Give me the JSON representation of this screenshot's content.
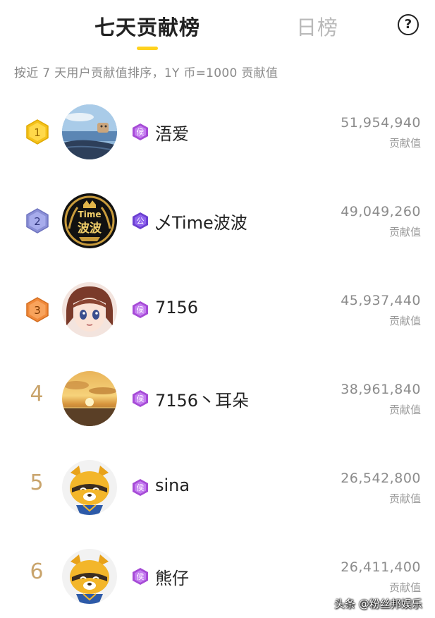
{
  "header": {
    "tab_active": "七天贡献榜",
    "tab_inactive": "日榜",
    "help_symbol": "?",
    "accent_color": "#ffd21e"
  },
  "subtitle": "按近 7 天用户贡献值排序，1Y 币=1000 贡献值",
  "rows": [
    {
      "rank": "1",
      "badge_color": "#f4c21b",
      "level": "侯",
      "level_color": "#a64bd6",
      "name": "浯爱",
      "value": "51,954,940",
      "unit": "贡献值",
      "avatar": "sea-landscape"
    },
    {
      "rank": "2",
      "badge_color": "#8a8fd6",
      "level": "公",
      "level_color": "#6b3fd0",
      "name": "乄Time波波",
      "value": "49,049,260",
      "unit": "贡献值",
      "avatar": "time-bobo-emblem"
    },
    {
      "rank": "3",
      "badge_color": "#f0893a",
      "level": "侯",
      "level_color": "#a64bd6",
      "name": "7156",
      "value": "45,937,440",
      "unit": "贡献值",
      "avatar": "anime-girl"
    },
    {
      "rank": "4",
      "level": "侯",
      "level_color": "#a64bd6",
      "name": "7156丶耳朵",
      "value": "38,961,840",
      "unit": "贡献值",
      "avatar": "sunset-sky"
    },
    {
      "rank": "5",
      "level": "侯",
      "level_color": "#a64bd6",
      "name": "sina",
      "value": "26,542,800",
      "unit": "贡献值",
      "avatar": "raccoon-mascot"
    },
    {
      "rank": "6",
      "level": "侯",
      "level_color": "#a64bd6",
      "name": "熊仔",
      "value": "26,411,400",
      "unit": "贡献值",
      "avatar": "raccoon-mascot"
    }
  ],
  "watermark": "头条 @粉丝邦娱乐"
}
